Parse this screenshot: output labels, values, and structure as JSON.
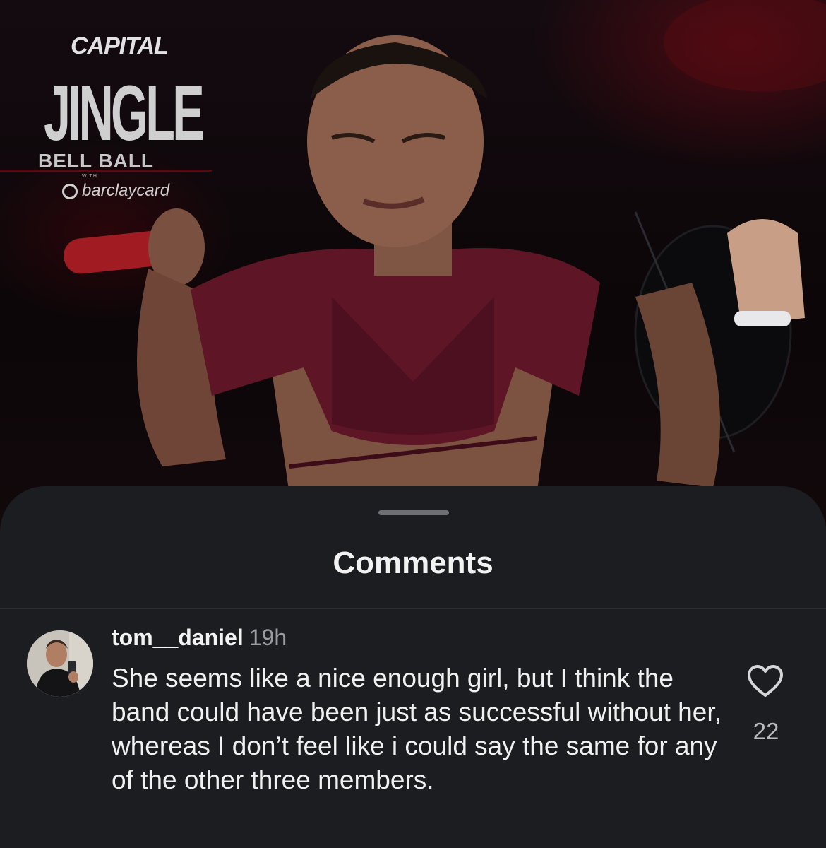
{
  "video": {
    "logo": {
      "brand": "CAPITAL",
      "event_line1": "JINGLE",
      "event_line2": "BELL BALL",
      "with_label": "WITH",
      "sponsor": "barclaycard"
    }
  },
  "comments_sheet": {
    "title": "Comments",
    "comments": [
      {
        "username": "tom__daniel",
        "time": "19h",
        "text": "She seems like a nice enough girl, but I think the band could have been just as successful without her, whereas I don’t feel like i could say the same for any of the other three members.",
        "likes": "22",
        "like_icon": "heart-outline-icon"
      }
    ]
  },
  "colors": {
    "sheet_background": "#1c1d21",
    "primary_text": "#f1f1f1",
    "secondary_text": "#9b9ca1"
  }
}
